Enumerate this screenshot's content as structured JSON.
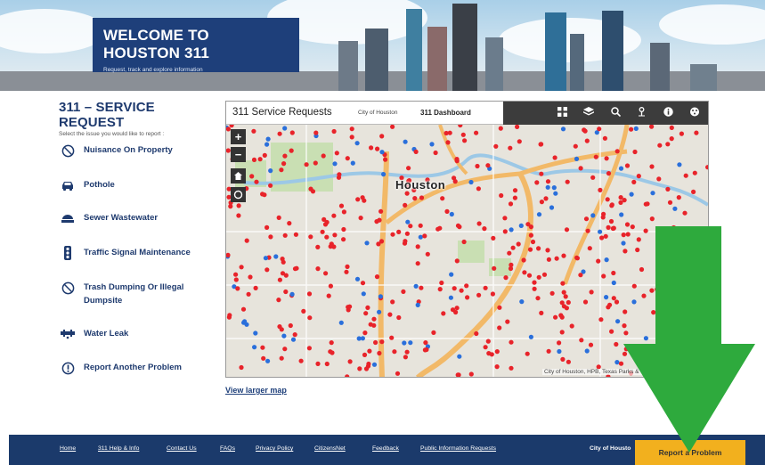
{
  "banner": {
    "title": "WELCOME TO HOUSTON 311",
    "subtitle": "Request, track and explore information"
  },
  "service_request": {
    "title": "311 – SERVICE REQUEST",
    "subtitle": "Select the issue you would like to report :",
    "items": [
      {
        "label": "Nuisance On Property",
        "icon": "no-entry-icon"
      },
      {
        "label": "Pothole",
        "icon": "car-icon"
      },
      {
        "label": "Sewer Wastewater",
        "icon": "manhole-icon"
      },
      {
        "label": "Traffic Signal Maintenance",
        "icon": "traffic-light-icon"
      },
      {
        "label": "Trash Dumping Or Illegal Dumpsite",
        "icon": "no-entry-icon"
      },
      {
        "label": "Water Leak",
        "icon": "pipe-icon"
      },
      {
        "label": "Report Another Problem",
        "icon": "exclamation-icon"
      }
    ]
  },
  "map": {
    "title": "311 Service Requests",
    "org": "City of Houston",
    "dashboard_label": "311 Dashboard",
    "city_label": "Houston",
    "attribution": "City of Houston, HPB, Texas Parks & Wildlife, Esri, HERE, Ga",
    "toolbar": [
      "grid-icon",
      "layers-icon",
      "search-icon",
      "locate-icon",
      "info-icon",
      "share-icon"
    ],
    "zoom_in": "+",
    "zoom_out": "−",
    "colors": {
      "open": "#e8232a",
      "closed": "#2a6fdb",
      "road": "#f2b968",
      "water": "#9cc8e6",
      "park": "#c9dfb3"
    }
  },
  "view_larger": "View larger map",
  "footer": {
    "links": [
      "Home",
      "311 Help & Info",
      "Contact Us",
      "FAQs",
      "Privacy Policy",
      "CitizensNet",
      "Feedback",
      "Public Information Requests"
    ],
    "right_text": "City of Housto",
    "report_button": "Report a Problem"
  },
  "overlay": {
    "arrow_color": "#2eaa3d"
  }
}
